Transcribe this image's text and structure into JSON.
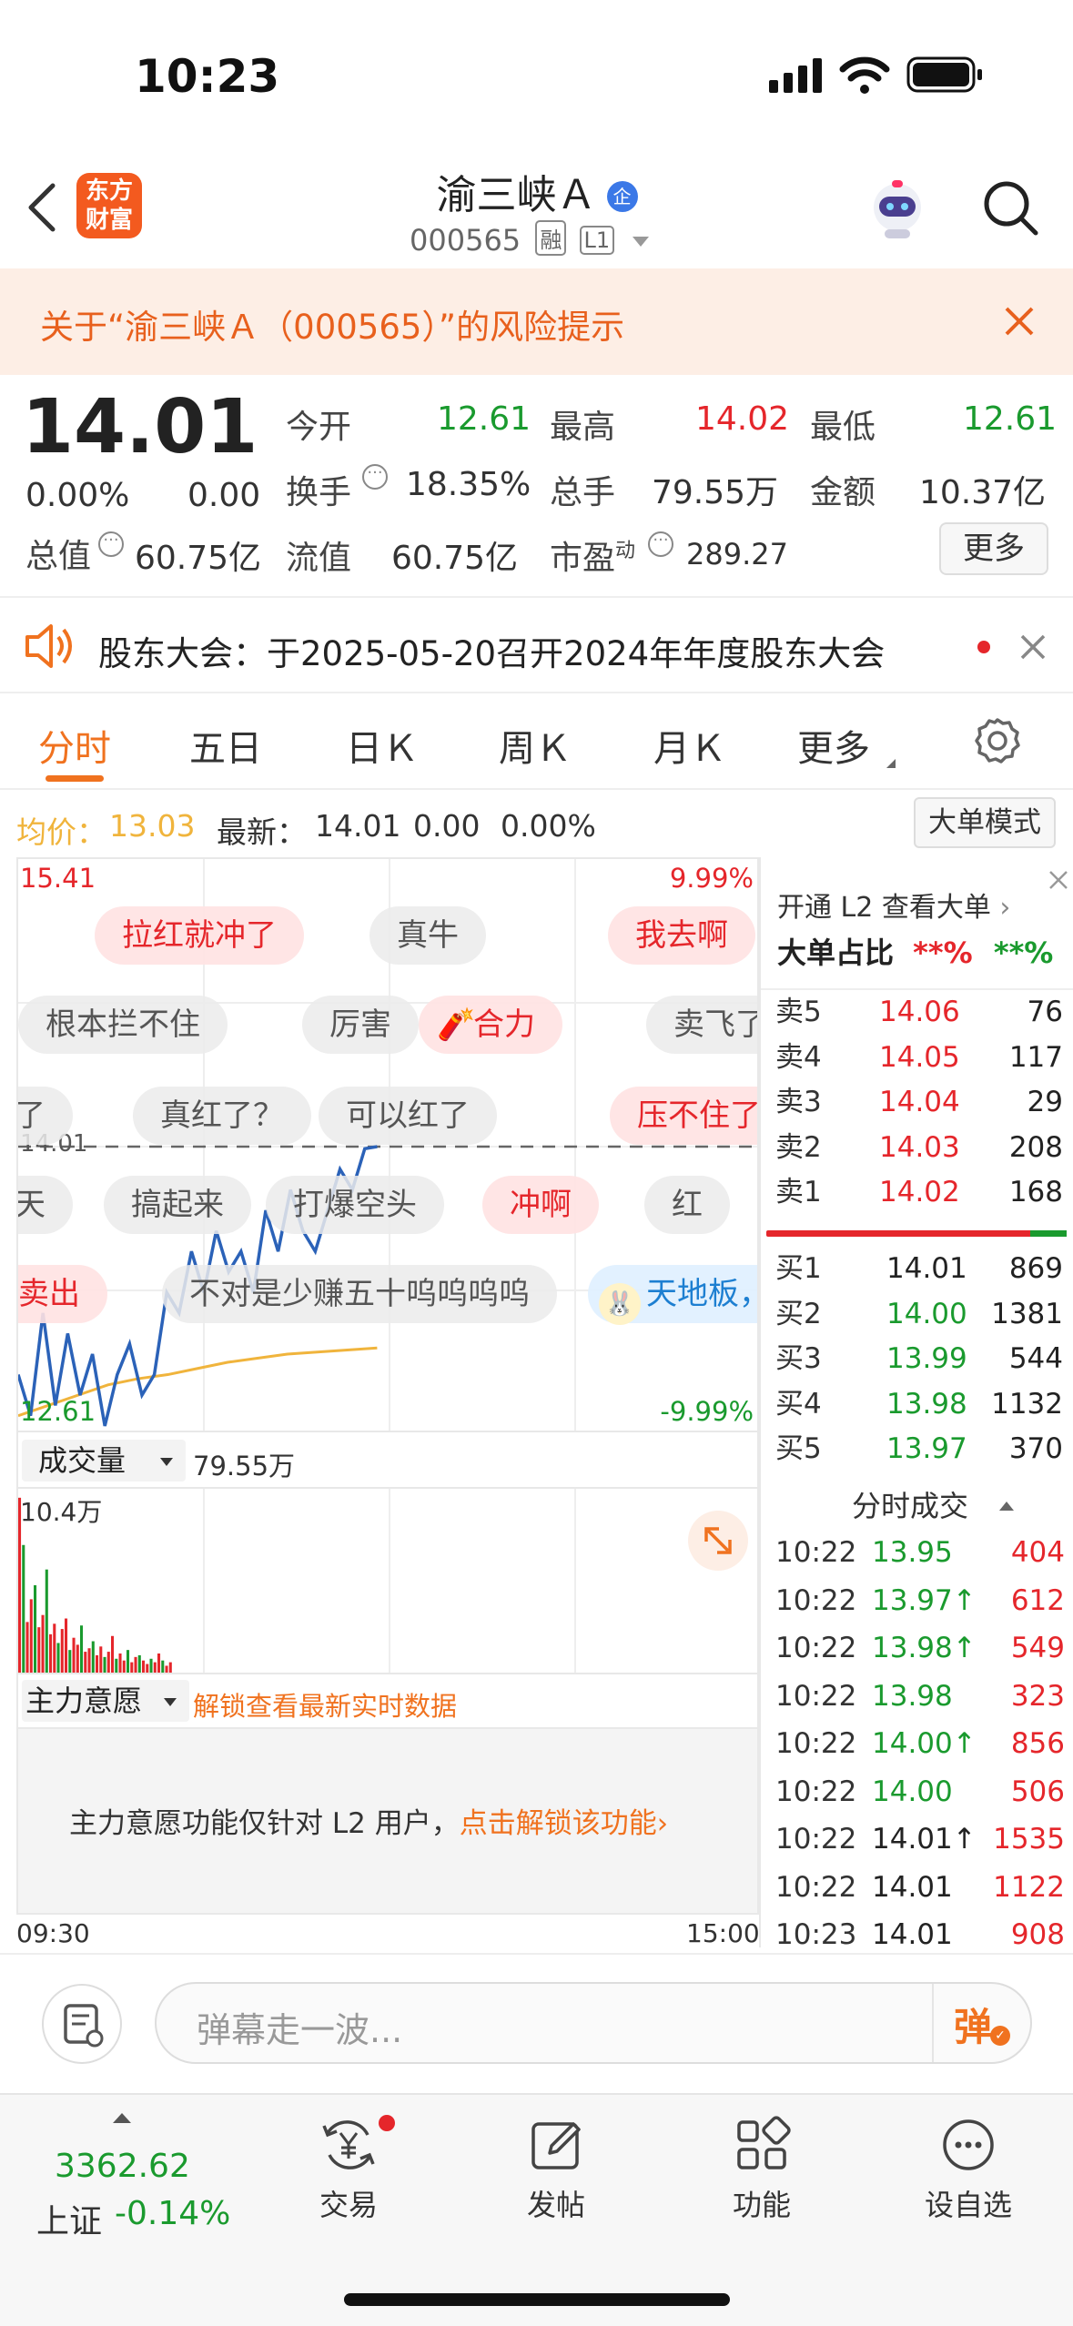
{
  "status_bar": {
    "time": "10:23"
  },
  "header": {
    "logo_line1": "东方",
    "logo_line2": "财富",
    "stock_name": "渝三峡Ａ",
    "badge_qi": "企",
    "stock_code": "000565",
    "tag_rong": "融",
    "tag_l1": "L1"
  },
  "risk_banner": {
    "text": "关于“渝三峡Ａ（000565）”的风险提示"
  },
  "quote": {
    "price": "14.01",
    "change_pct": "0.00%",
    "change": "0.00",
    "open_label": "今开",
    "open": "12.61",
    "high_label": "最高",
    "high": "14.02",
    "low_label": "最低",
    "low": "12.61",
    "turnover_label": "换手",
    "turnover": "18.35%",
    "volume_label": "总手",
    "volume": "79.55万",
    "amount_label": "金额",
    "amount": "10.37亿",
    "mktcap_label": "总值",
    "mktcap": "60.75亿",
    "float_label": "流值",
    "float_cap": "60.75亿",
    "pe_label": "市盈",
    "pe_sup": "动",
    "pe": "289.27",
    "more_label": "更多"
  },
  "notice": {
    "text": "股东大会：于2025-05-20召开2024年年度股东大会"
  },
  "tabs": [
    {
      "label": "分时",
      "active": true
    },
    {
      "label": "五日"
    },
    {
      "label": "日Ｋ"
    },
    {
      "label": "周Ｋ"
    },
    {
      "label": "月Ｋ"
    },
    {
      "label": "更多"
    }
  ],
  "chart_info": {
    "avg_label": "均价：",
    "avg_value": "13.03",
    "latest_label": "最新：",
    "latest_value": "14.01",
    "latest_change": "0.00",
    "latest_pct": "0.00%",
    "big_order_btn": "大单模式"
  },
  "price_chart": {
    "y_top": "15.41",
    "y_top_pct": "9.99%",
    "y_bottom": "12.61",
    "y_bottom_pct": "-9.99%",
    "ref_price": "14.01",
    "x_start": "09:30",
    "x_end": "15:00"
  },
  "chart_data": [
    {
      "type": "line",
      "title": "",
      "ylim": [
        12.61,
        15.41
      ],
      "series": [
        {
          "values": [
            12.9,
            12.7,
            13.2,
            12.75,
            13.1,
            12.8,
            13.0,
            12.65,
            12.9,
            13.05,
            12.8,
            12.9,
            13.3,
            13.2,
            13.5,
            13.3,
            13.6,
            13.4,
            13.5,
            13.3,
            13.7,
            13.5,
            13.8,
            13.6,
            13.5,
            13.7,
            13.9,
            13.8,
            14.0,
            14.01
          ]
        },
        {
          "values": [
            12.7,
            12.75,
            12.8,
            12.85,
            12.88,
            12.9,
            12.93,
            12.96,
            12.98,
            13.0,
            13.01,
            13.02,
            13.03
          ]
        }
      ]
    },
    {
      "type": "bar",
      "title": "",
      "ylim": [
        0,
        10.4
      ],
      "values": [
        10.2,
        7.5,
        3.1,
        4.4,
        5.2,
        2.8,
        3.5,
        6.1,
        2.4,
        3.0,
        1.9,
        2.7,
        3.3,
        1.5,
        2.2,
        1.8,
        2.9,
        1.4,
        1.6,
        2.0,
        1.2,
        1.7,
        1.1,
        1.4,
        2.3,
        1.0,
        1.3,
        0.9,
        1.5,
        0.8,
        1.1,
        1.2,
        0.9,
        0.7,
        1.0,
        0.8,
        1.3,
        0.9,
        0.6,
        0.8
      ]
    }
  ],
  "danmaku": [
    "拉红就冲了",
    "真牛",
    "我去啊",
    "根本拦不住",
    "厉害",
    "合力",
    "卖飞了",
    "了",
    "真红了？",
    "可以红了",
    "压不住了",
    "天",
    "搞起来",
    "打爆空头",
    "冲啊",
    "红",
    "卖出",
    "不对是少赚五十呜呜呜呜",
    "天地板，"
  ],
  "volume_panel": {
    "label": "成交量",
    "value": "79.55万",
    "max": "10.4万"
  },
  "main_force": {
    "label": "主力意愿",
    "unlock": "解锁查看最新实时数据",
    "message": "主力意愿功能仅针对 L2 用户，",
    "link": "点击解锁该功能"
  },
  "side_panel": {
    "l2_promo": "开通 L2 查看大单",
    "big_ratio_label": "大单占比",
    "big_ratio_a": "**%",
    "big_ratio_b": "**%",
    "sell": [
      {
        "label": "卖5",
        "price": "14.06",
        "vol": "76"
      },
      {
        "label": "卖4",
        "price": "14.05",
        "vol": "117"
      },
      {
        "label": "卖3",
        "price": "14.04",
        "vol": "29"
      },
      {
        "label": "卖2",
        "price": "14.03",
        "vol": "208"
      },
      {
        "label": "卖1",
        "price": "14.02",
        "vol": "168"
      }
    ],
    "buy": [
      {
        "label": "买1",
        "price": "14.01",
        "vol": "869"
      },
      {
        "label": "买2",
        "price": "14.00",
        "vol": "1381"
      },
      {
        "label": "买3",
        "price": "13.99",
        "vol": "544"
      },
      {
        "label": "买4",
        "price": "13.98",
        "vol": "1132"
      },
      {
        "label": "买5",
        "price": "13.97",
        "vol": "370"
      }
    ],
    "ticks_title": "分时成交",
    "ticks": [
      {
        "time": "10:22",
        "price": "13.95",
        "vol": "404"
      },
      {
        "time": "10:22",
        "price": "13.97↑",
        "vol": "612"
      },
      {
        "time": "10:22",
        "price": "13.98↑",
        "vol": "549"
      },
      {
        "time": "10:22",
        "price": "13.98",
        "vol": "323"
      },
      {
        "time": "10:22",
        "price": "14.00↑",
        "vol": "856"
      },
      {
        "time": "10:22",
        "price": "14.00",
        "vol": "506"
      },
      {
        "time": "10:22",
        "price": "14.01↑",
        "vol": "1535"
      },
      {
        "time": "10:22",
        "price": "14.01",
        "vol": "1122"
      },
      {
        "time": "10:23",
        "price": "14.01",
        "vol": "908"
      }
    ]
  },
  "comment_bar": {
    "placeholder": "弹幕走一波...",
    "danmaku_btn": "弹"
  },
  "bottom_bar": {
    "index_value": "3362.62",
    "index_name": "上证",
    "index_change": "-0.14%",
    "items": [
      "交易",
      "发帖",
      "功能",
      "设自选"
    ]
  },
  "colors": {
    "up": "#e5262b",
    "down": "#1a9a2e",
    "accent": "#f0721f",
    "avg_line": "#f0b43c",
    "price_line": "#2b62b8"
  }
}
